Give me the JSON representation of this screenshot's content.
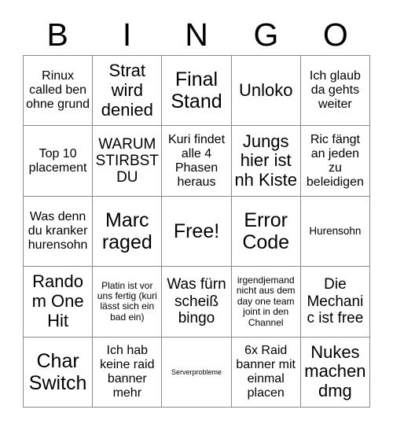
{
  "header": {
    "letters": [
      "B",
      "I",
      "N",
      "G",
      "O"
    ]
  },
  "grid": {
    "columns": 5,
    "rows": 5,
    "border_color": "#8a8a8a",
    "background_color": "#ffffff",
    "text_color": "#000000",
    "cells": [
      {
        "text": "Rinux called ben ohne grund",
        "size": "md"
      },
      {
        "text": "Strat wird denied",
        "size": "xl"
      },
      {
        "text": "Final Stand",
        "size": "xxl"
      },
      {
        "text": "Unloko",
        "size": "xl"
      },
      {
        "text": "Ich glaub da gehts weiter",
        "size": "md"
      },
      {
        "text": "Top 10 placement",
        "size": "md"
      },
      {
        "text": "WARUM STIRBST DU",
        "size": "lg"
      },
      {
        "text": "Kuri findet alle 4 Phasen heraus",
        "size": "md"
      },
      {
        "text": "Jungs hier ist nh Kiste",
        "size": "xl"
      },
      {
        "text": "Ric fängt an jeden zu beleidigen",
        "size": "md"
      },
      {
        "text": "Was denn du kranker hurensohn",
        "size": "md"
      },
      {
        "text": "Marc raged",
        "size": "xxl"
      },
      {
        "text": "Free!",
        "size": "xxl"
      },
      {
        "text": "Error Code",
        "size": "xxl"
      },
      {
        "text": "Hurensohn",
        "size": "sm"
      },
      {
        "text": "Random One Hit",
        "size": "xl"
      },
      {
        "text": "Platin ist vor uns fertig (kuri lässt sich ein bad ein)",
        "size": "xs"
      },
      {
        "text": "Was fürn scheiß bingo",
        "size": "lg"
      },
      {
        "text": "irgendjemand nicht aus dem day one team joint in den Channel",
        "size": "xs"
      },
      {
        "text": "Die Mechanic ist free",
        "size": "lg"
      },
      {
        "text": "Char Switch",
        "size": "xxl"
      },
      {
        "text": "Ich hab keine raid banner mehr",
        "size": "md"
      },
      {
        "text": "Serverprobleme",
        "size": "xxs"
      },
      {
        "text": "6x Raid banner mit einmal placen",
        "size": "md"
      },
      {
        "text": "Nukes machen dmg",
        "size": "xl"
      }
    ]
  }
}
